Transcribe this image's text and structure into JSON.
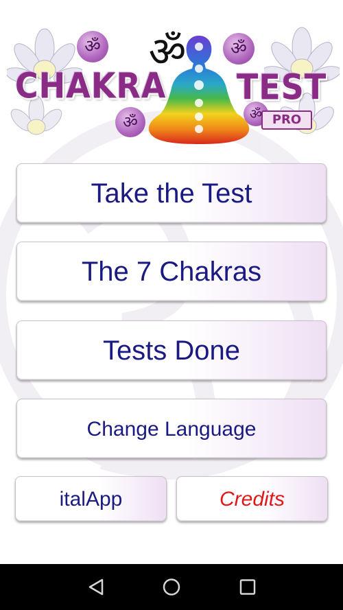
{
  "header": {
    "title_left": "CHAKRA",
    "title_right": "TEST",
    "badge": "PRO",
    "om_symbol": "ॐ",
    "illustration": "meditating-figure-with-chakras"
  },
  "menu": {
    "take_test": "Take the Test",
    "seven_chakras": "The 7 Chakras",
    "tests_done": "Tests Done",
    "change_language": "Change Language",
    "italapp": "italApp",
    "credits": "Credits"
  },
  "colors": {
    "button_text": "#1b1a82",
    "credits_text": "#e0181a",
    "title": "#8a2b86",
    "navbar": "#000000"
  },
  "navbar": {
    "back_icon": "back-triangle-icon",
    "home_icon": "home-circle-icon",
    "recents_icon": "recents-square-icon"
  }
}
